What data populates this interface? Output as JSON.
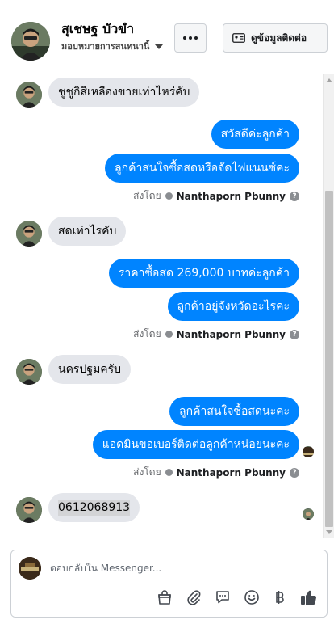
{
  "header": {
    "name": "สุเชษฐ บัวขำ",
    "assign_label": "มอบหมายการสนทนานี้",
    "more_label": "more-options",
    "contact_button_label": "ดูข้อมูลติดต่อ"
  },
  "messages": [
    {
      "side": "in",
      "text": "ชูชูกิสีเหลืองขายเท่าไหร่คับ"
    },
    {
      "side": "out",
      "text": "สวัสดีค่ะลูกค้า"
    },
    {
      "side": "out",
      "text": "ลูกค้าสนใจซื้อสดหรือจัดไฟแนนซ์คะ"
    },
    {
      "side": "sent_by",
      "prefix": "ส่งโดย",
      "who": "Nanthaporn Pbunny"
    },
    {
      "side": "in",
      "text": "สดเท่าไรคับ"
    },
    {
      "side": "out",
      "text": "ราคาซื้อสด 269,000 บาทค่ะลูกค้า"
    },
    {
      "side": "out",
      "text": "ลูกค้าอยู่จังหวัดอะไรคะ"
    },
    {
      "side": "sent_by",
      "prefix": "ส่งโดย",
      "who": "Nanthaporn Pbunny"
    },
    {
      "side": "in",
      "text": "นครปฐมครับ"
    },
    {
      "side": "out",
      "text": "ลูกค้าสนใจซื้อสดนะคะ"
    },
    {
      "side": "out",
      "text": "แอดมินขอเบอร์ติดต่อลูกค้าหน่อยนะคะ"
    },
    {
      "side": "sent_by",
      "prefix": "ส่งโดย",
      "who": "Nanthaporn Pbunny"
    },
    {
      "side": "in",
      "text": "0612068913"
    }
  ],
  "composer": {
    "placeholder": "ตอบกลับใน Messenger..."
  },
  "toolbar_icons": [
    "bag-icon",
    "paperclip-icon",
    "chat-bubble-icon",
    "emoji-icon",
    "baht-icon",
    "thumbs-up-icon"
  ],
  "colors": {
    "outgoing_bubble": "#0084ff",
    "incoming_bubble": "#e4e6eb"
  }
}
